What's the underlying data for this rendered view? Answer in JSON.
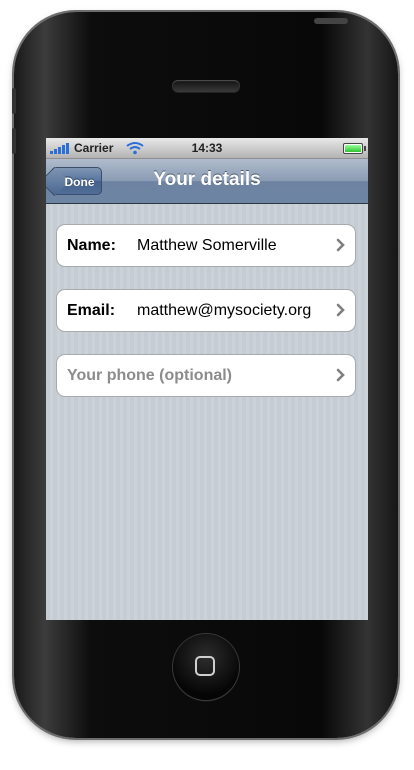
{
  "status_bar": {
    "carrier": "Carrier",
    "time": "14:33",
    "signal_icon": "signal-bars-icon",
    "wifi_icon": "wifi-icon",
    "battery_icon": "battery-icon",
    "battery_level": 1.0
  },
  "nav": {
    "back_label": "Done",
    "title": "Your details"
  },
  "rows": [
    {
      "label": "Name:",
      "value": "Matthew Somerville",
      "icon": "chevron-right-icon"
    },
    {
      "label": "Email:",
      "value": "matthew@mysociety.org",
      "icon": "chevron-right-icon"
    },
    {
      "placeholder": "Your phone (optional)",
      "icon": "chevron-right-icon"
    }
  ],
  "colors": {
    "nav_bar": "#6d84a2",
    "background": "#c5ccd4",
    "signal": "#2a6ed8",
    "battery": "#2ec42e"
  }
}
